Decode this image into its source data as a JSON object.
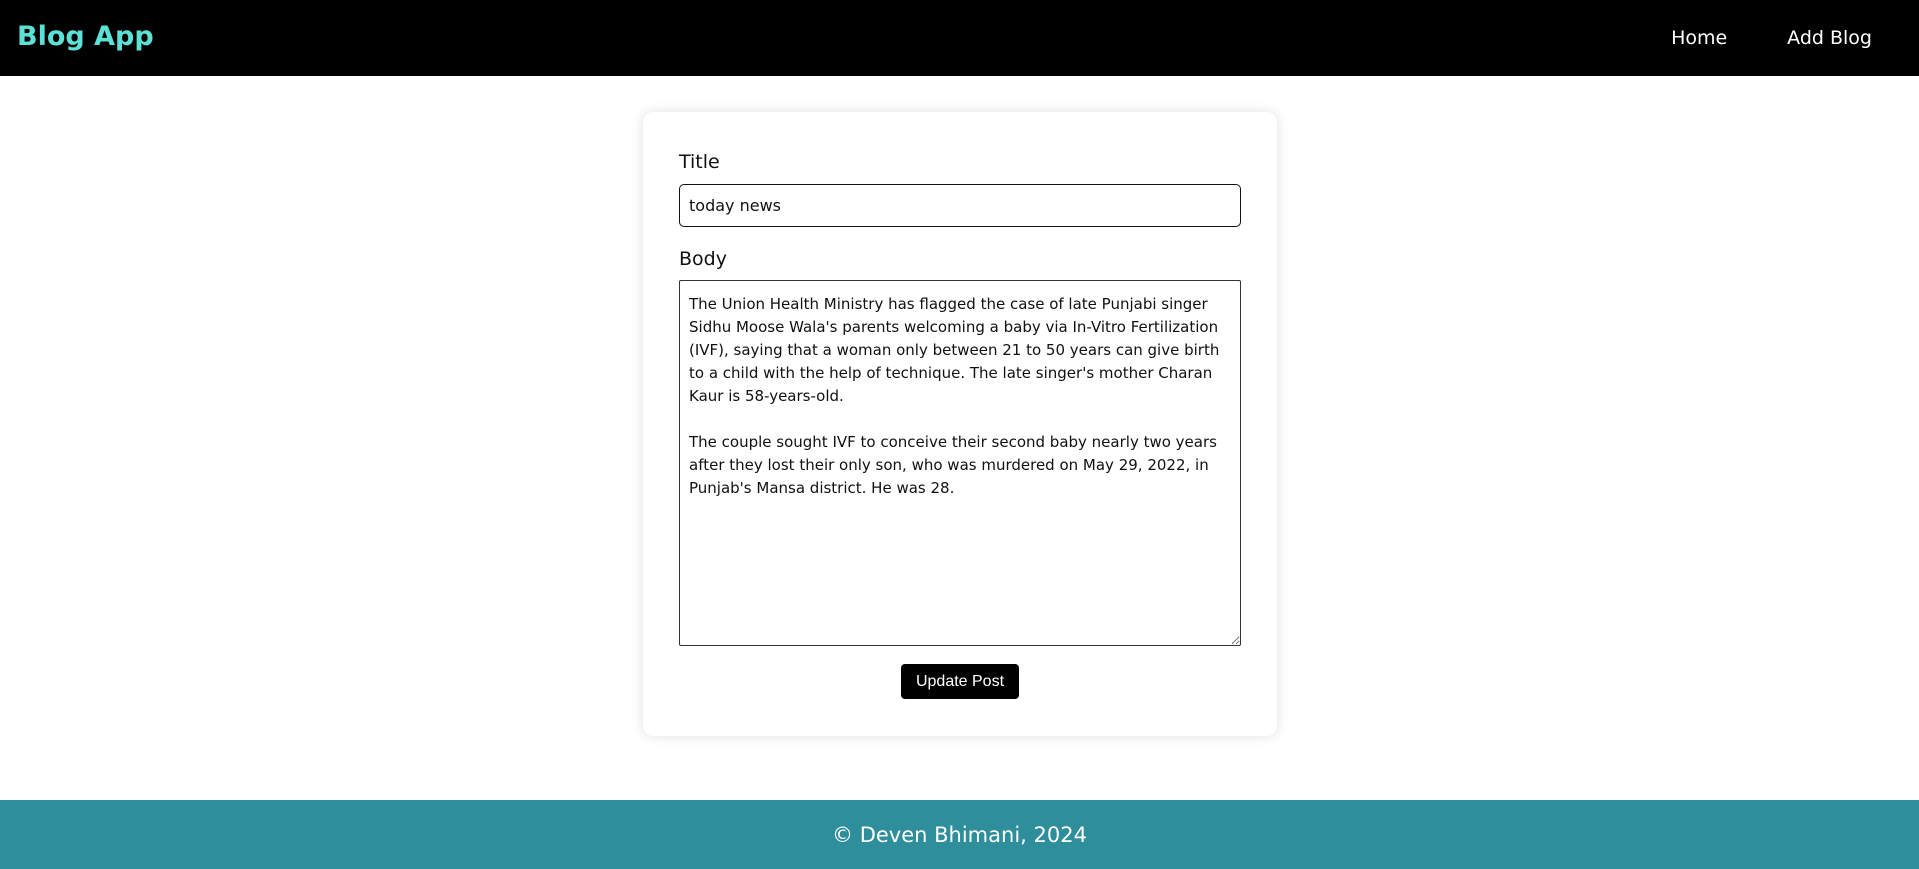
{
  "colors": {
    "brand": "#5ce1d6",
    "navbar_bg": "#000000",
    "footer_bg": "#2e8e9b",
    "button_bg": "#000000"
  },
  "navbar": {
    "brand": "Blog App",
    "links": [
      {
        "label": "Home"
      },
      {
        "label": "Add Blog"
      }
    ]
  },
  "form": {
    "title_label": "Title",
    "title_value": "today news",
    "body_label": "Body",
    "body_value": "The Union Health Ministry has flagged the case of late Punjabi singer Sidhu Moose Wala's parents welcoming a baby via In-Vitro Fertilization (IVF), saying that a woman only between 21 to 50 years can give birth to a child with the help of technique. The late singer's mother Charan Kaur is 58-years-old.\n\nThe couple sought IVF to conceive their second baby nearly two years after they lost their only son, who was murdered on May 29, 2022, in Punjab's Mansa district. He was 28.",
    "submit_label": "Update Post"
  },
  "footer": {
    "text": "© Deven Bhimani, 2024"
  }
}
